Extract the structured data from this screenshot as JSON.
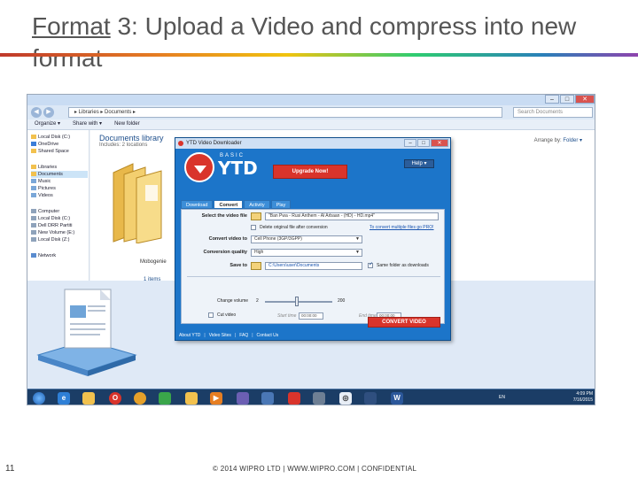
{
  "slide": {
    "title_underlined": "Format",
    "title_rest": " 3: Upload a Video and compress into new format",
    "number": "11",
    "footer": "© 2014 WIPRO LTD | WWW.WIPRO.COM | CONFIDENTIAL"
  },
  "explorer": {
    "address": "▸ Libraries ▸ Documents ▸",
    "search_placeholder": "Search Documents",
    "commands": [
      "Organize ▾",
      "Share with ▾",
      "New folder"
    ],
    "nav": [
      {
        "label": "Local Disk (C:)"
      },
      {
        "label": "OneDrive"
      },
      {
        "label": "Shared Space"
      },
      {
        "label": "Libraries"
      },
      {
        "label": "Documents"
      },
      {
        "label": "Music"
      },
      {
        "label": "Pictures"
      },
      {
        "label": "Videos"
      },
      {
        "label": "Computer"
      },
      {
        "label": "Local Disk (C:)"
      },
      {
        "label": "Dell DRR Partiti"
      },
      {
        "label": "New Volume (E:)"
      },
      {
        "label": "Local Disk (Z:)"
      },
      {
        "label": "Network"
      }
    ],
    "library_title": "Documents library",
    "library_sub": "Includes: 2 locations",
    "arrange_label": "Arrange by:",
    "arrange_value": "Folder ▾",
    "folder_label": "Mobogenie",
    "items_count": "1 items"
  },
  "ytd": {
    "window_title": "YTD Video Downloader",
    "logo_basic": "BASIC",
    "logo_text": "YTD",
    "upgrade_label": "Upgrade Now!",
    "help_label": "Help ▾",
    "tabs": [
      "Download",
      "Convert",
      "Activity",
      "Play"
    ],
    "active_tab": "Convert",
    "select_label": "Select the video file",
    "select_value": "\"Ban Pwa - Rusi Anthem - Al Arbaan - (HD) - HD.mp4\"",
    "delete_label": "Delete original file after conversion",
    "multiple_link": "To convert multiple files go PRO!",
    "convert_to_label": "Convert video to",
    "convert_to_value": "Cell Phone (3GP/3GPP)",
    "quality_label": "Conversion quality",
    "quality_value": "High",
    "save_label": "Save to",
    "save_value": "C:\\Users\\user\\Documents",
    "same_folder_label": "Same folder as downloads",
    "volume_label": "Change volume",
    "volume_min": "2",
    "volume_max": "200",
    "cut_label": "Cut video",
    "start_label": "Start time",
    "start_value": "00:00:00",
    "end_label": "End time",
    "end_value": "00:00:00",
    "convert_button": "CONVERT VIDEO",
    "footer_links": [
      "About YTD",
      "Video Sites",
      "FAQ",
      "Contact Us"
    ]
  },
  "taskbar": {
    "lang": "EN",
    "time": "4:09 PM",
    "date": "7/16/2015"
  }
}
